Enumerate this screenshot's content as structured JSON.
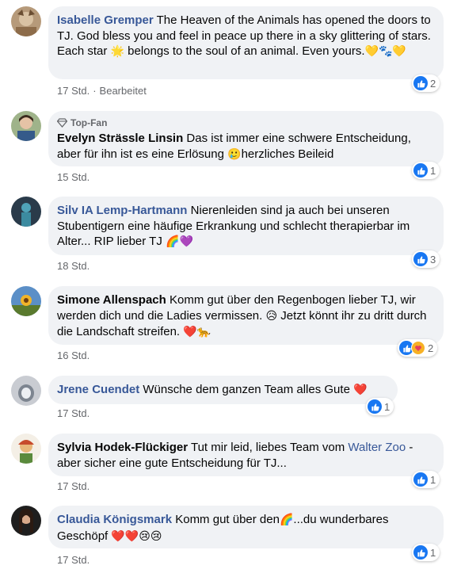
{
  "comments": [
    {
      "author": "Isabelle Gremper",
      "text1": "The Heaven of the Animals has opened the doors to TJ. God bless you and feel in peace up there in a sky glittering of stars. Each star",
      "sun": "🌟",
      "text2": "belongs to the soul of an animal. Even yours.",
      "emojis": "💛🐾💛",
      "time": "17 Std.",
      "edited": "Bearbeitet",
      "reactions": "2"
    },
    {
      "badge": "Top-Fan",
      "author": "Evelyn Strässle Linsin",
      "text1": "Das ist immer eine schwere Entscheidung, aber für ihn ist es eine Erlösung",
      "emoji": "🥲",
      "text2": "herzliches Beileid",
      "time": "15 Std.",
      "reactions": "1"
    },
    {
      "author": "Silv IA Lemp-Hartmann",
      "text1": "Nierenleiden sind ja auch bei unseren Stubentigern eine häufige Erkrankung und schlecht therapierbar im Alter... RIP lieber TJ",
      "emojis": "🌈💜",
      "time": "18 Std.",
      "reactions": "3"
    },
    {
      "author": "Simone Allenspach",
      "text1": "Komm gut über den Regenbogen lieber TJ, wir werden dich und die Ladies vermissen.",
      "emoji": "😥",
      "text2": "Jetzt könnt ihr zu dritt durch die Landschaft streifen.",
      "emojis": "❤️🐆",
      "time": "16 Std.",
      "reactions": "2"
    },
    {
      "author": "Jrene Cuendet",
      "text1": "Wünsche dem ganzen Team alles Gute",
      "emojis": "❤️",
      "time": "17 Std.",
      "reactions": "1"
    },
    {
      "author": "Sylvia Hodek-Flückiger",
      "text1": "Tut mir leid, liebes Team vom",
      "link": "Walter Zoo",
      "text2": "- aber sicher eine gute Entscheidung für TJ...",
      "time": "17 Std.",
      "reactions": "1"
    },
    {
      "author": "Claudia Königsmark",
      "text1": "Komm gut über den",
      "emoji": "🌈",
      "text2": "...du wunderbares Geschöpf",
      "emojis": "❤️❤️😢😢",
      "time": "17 Std.",
      "reactions": "1"
    }
  ],
  "colors": {
    "bubble": "#f0f2f5",
    "like": "#1877f2",
    "name_link": "#385898",
    "meta": "#65676b"
  },
  "icons": {
    "like": "thumbs-up-icon",
    "care": "care-emoji-icon",
    "topfan": "diamond-icon"
  }
}
